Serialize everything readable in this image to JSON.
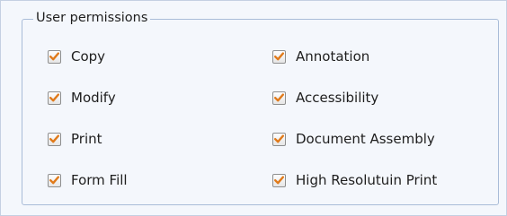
{
  "group": {
    "title": "User permissions"
  },
  "accent_color": "#e07a1a",
  "check_icon": "check-icon",
  "permissions": {
    "copy": {
      "label": "Copy",
      "checked": true
    },
    "annotation": {
      "label": "Annotation",
      "checked": true
    },
    "modify": {
      "label": "Modify",
      "checked": true
    },
    "accessibility": {
      "label": "Accessibility",
      "checked": true
    },
    "print": {
      "label": "Print",
      "checked": true
    },
    "document_assembly": {
      "label": "Document Assembly",
      "checked": true
    },
    "form_fill": {
      "label": "Form Fill",
      "checked": true
    },
    "high_resolution_print": {
      "label": "High Resolutuin Print",
      "checked": true
    }
  }
}
